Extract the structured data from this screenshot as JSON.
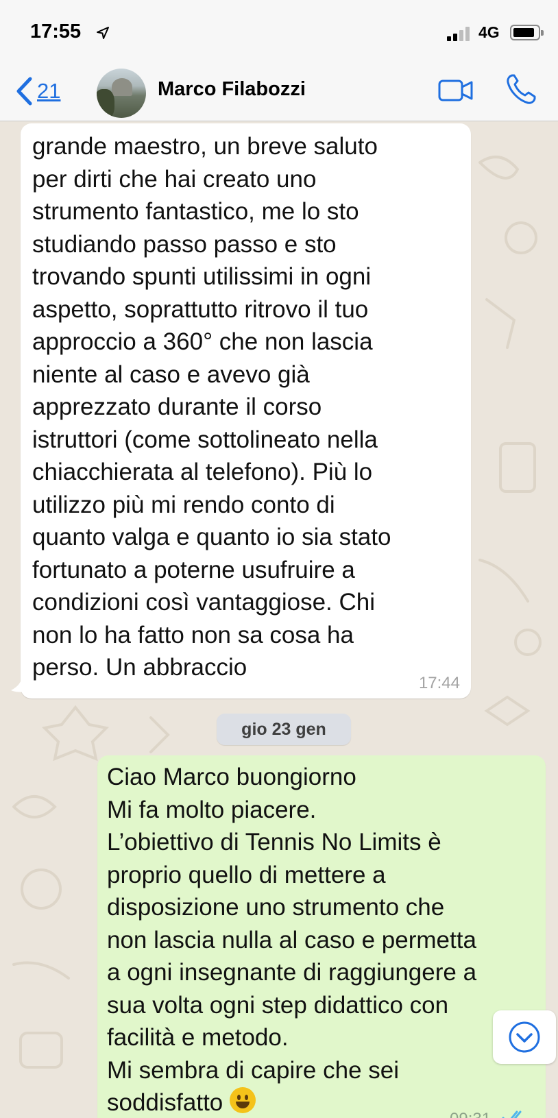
{
  "status_bar": {
    "time": "17:55",
    "network": "4G"
  },
  "header": {
    "back_count": "21",
    "contact_name": "Marco Filabozzi"
  },
  "messages": [
    {
      "direction": "incoming",
      "text": "grande maestro, un breve saluto\nper dirti che hai creato uno\nstrumento fantastico, me lo sto\nstudiando passo passo e sto\ntrovando spunti utilissimi in ogni\naspetto, soprattutto ritrovo il tuo\napproccio a 360° che non lascia\nniente al caso e avevo già\napprezzato durante il corso\nistruttori (come sottolineato nella\nchiacchierata al telefono). Più lo\nutilizzo più mi rendo conto di\nquanto valga e quanto io sia stato\nfortunato a poterne usufruire a\ncondizioni così vantaggiose. Chi\nnon lo ha fatto non sa cosa ha\nperso. Un abbraccio",
      "time": "17:44"
    },
    {
      "direction": "outgoing",
      "text": "Ciao Marco buongiorno\nMi fa molto piacere.\nL’obiettivo di Tennis No Limits  è\nproprio quello di mettere a\ndisposizione uno strumento che\nnon lascia nulla al caso e permetta\na ogni insegnante di raggiungere a\nsua volta ogni step didattico con\nfacilità e metodo.\nMi sembra di capire che sei\nsoddisfatto",
      "time": "09:31"
    }
  ],
  "date_separator": "gio 23 gen",
  "icons": {
    "back": "chevron-left-icon",
    "location": "location-arrow-icon",
    "video": "video-camera-icon",
    "call": "phone-icon",
    "scroll": "chevron-down-circle-icon",
    "emoji": "grinning-face-emoji",
    "read": "double-check-icon"
  },
  "colors": {
    "accent": "#1f6fe0",
    "incoming_bubble": "#ffffff",
    "outgoing_bubble": "#e1f7cb",
    "chat_background": "#ebe5dc"
  }
}
